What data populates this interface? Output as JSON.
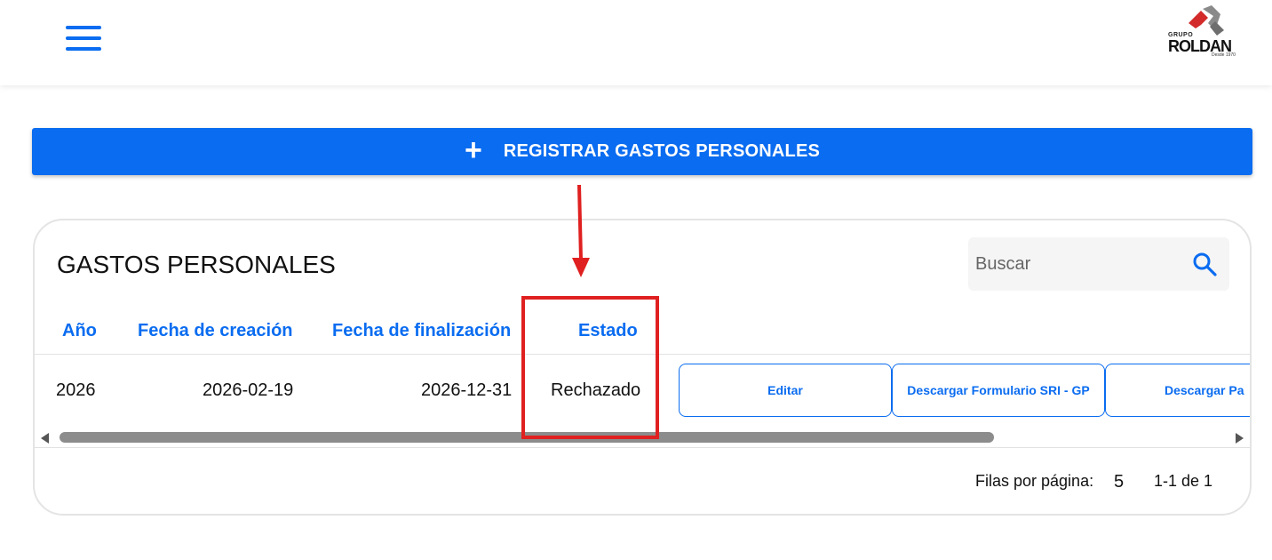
{
  "header": {
    "logo": {
      "grupo": "GRUPO",
      "name": "ROLDAN",
      "tagline": "Desde 1970"
    }
  },
  "register_button": {
    "label": "REGISTRAR GASTOS PERSONALES",
    "icon": "plus-icon"
  },
  "card": {
    "title": "GASTOS PERSONALES",
    "search": {
      "placeholder": "Buscar",
      "value": "",
      "icon": "search-icon"
    },
    "columns": [
      "Año",
      "Fecha de creación",
      "Fecha de finalización",
      "Estado"
    ],
    "rows": [
      {
        "year": "2026",
        "created": "2026-02-19",
        "finished": "2026-12-31",
        "status": "Rechazado",
        "actions": [
          "Editar",
          "Descargar Formulario SRI - GP",
          "Descargar Pa"
        ]
      }
    ],
    "pagination": {
      "rows_per_page_label": "Filas por página:",
      "rows_per_page": "5",
      "range": "1-1 de 1"
    }
  },
  "colors": {
    "primary": "#0a6cf0",
    "annotation": "#e02020",
    "text": "#111111"
  }
}
